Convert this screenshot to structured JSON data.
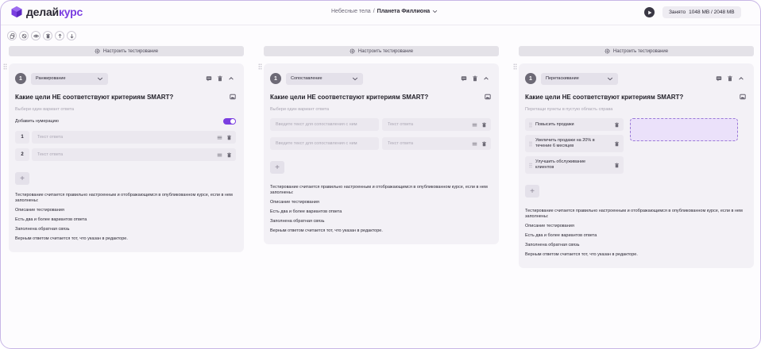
{
  "header": {
    "logo_part1": "делай",
    "logo_part2": "курс",
    "breadcrumb_parent": "Небесные тела",
    "breadcrumb_sep": "/",
    "breadcrumb_current": "Планета Филлиона",
    "storage_label": "Занято",
    "storage_value": "1048 MB / 2048 MB"
  },
  "toolbar_icons": [
    "copy-icon",
    "hide-icon",
    "eye-icon",
    "trash-icon",
    "arrow-up-icon",
    "arrow-down-icon"
  ],
  "configure_label": "Настроить тестирование",
  "colors": {
    "accent": "#7a3ee0",
    "card_bg": "#f3f1f6",
    "drop_zone": "#ebe1fa"
  },
  "columns": [
    {
      "number": "1",
      "type": "Ранжирование",
      "question": "Какие цели НЕ соответствуют критериям SMART?",
      "hint": "Выбери один вариант ответа",
      "numbering_label": "Добавить нумерацию",
      "numbering_enabled": true,
      "answers": [
        {
          "index": "1",
          "placeholder": "Текст ответа"
        },
        {
          "index": "2",
          "placeholder": "Текст ответа"
        }
      ],
      "add_label": "+",
      "info_lead": "Тестирование считается правильно настроенным и отображающимся в опубликованном курсе, если в нем заполнены:",
      "info_items": [
        "Описание тестирования",
        "Есть два и более вариантов ответа",
        "Заполнена обратная связь",
        "Верным ответом считается тот, что указан в редакторе."
      ]
    },
    {
      "number": "1",
      "type": "Сопоставление",
      "question": "Какие цели НЕ соответствуют критериям SMART?",
      "hint": "Выбери один вариант ответа",
      "pairs": [
        {
          "left": "Введите текст для сопоставления с ним",
          "right": "Текст ответа"
        },
        {
          "left": "Введите текст для сопоставления с ним",
          "right": "Текст ответа"
        }
      ],
      "add_label": "+",
      "info_lead": "Тестирование считается правильно настроенным и отображающимся в опубликованном курсе, если в нем заполнены:",
      "info_items": [
        "Описание тестирования",
        "Есть два и более вариантов ответа",
        "Заполнена обратная связь",
        "Верным ответом считается тот, что указан в редакторе."
      ]
    },
    {
      "number": "1",
      "type": "Перетаскивание",
      "question": "Какие цели НЕ соответствуют критериям SMART?",
      "hint": "Перетащи пункты в пустую область справа",
      "drag_items": [
        "Повысить продажи",
        "Увеличить продажи на 20% в течение 6 месяцев",
        "Улучшить обслуживание клиентов"
      ],
      "add_label": "+",
      "info_lead": "Тестирование считается правильно настроенным и отображающимся в опубликованном курсе, если в нем заполнены:",
      "info_items": [
        "Описание тестирования",
        "Есть два и более вариантов ответа",
        "Заполнена обратная связь",
        "Верным ответом считается тот, что указан в редакторе."
      ]
    }
  ]
}
